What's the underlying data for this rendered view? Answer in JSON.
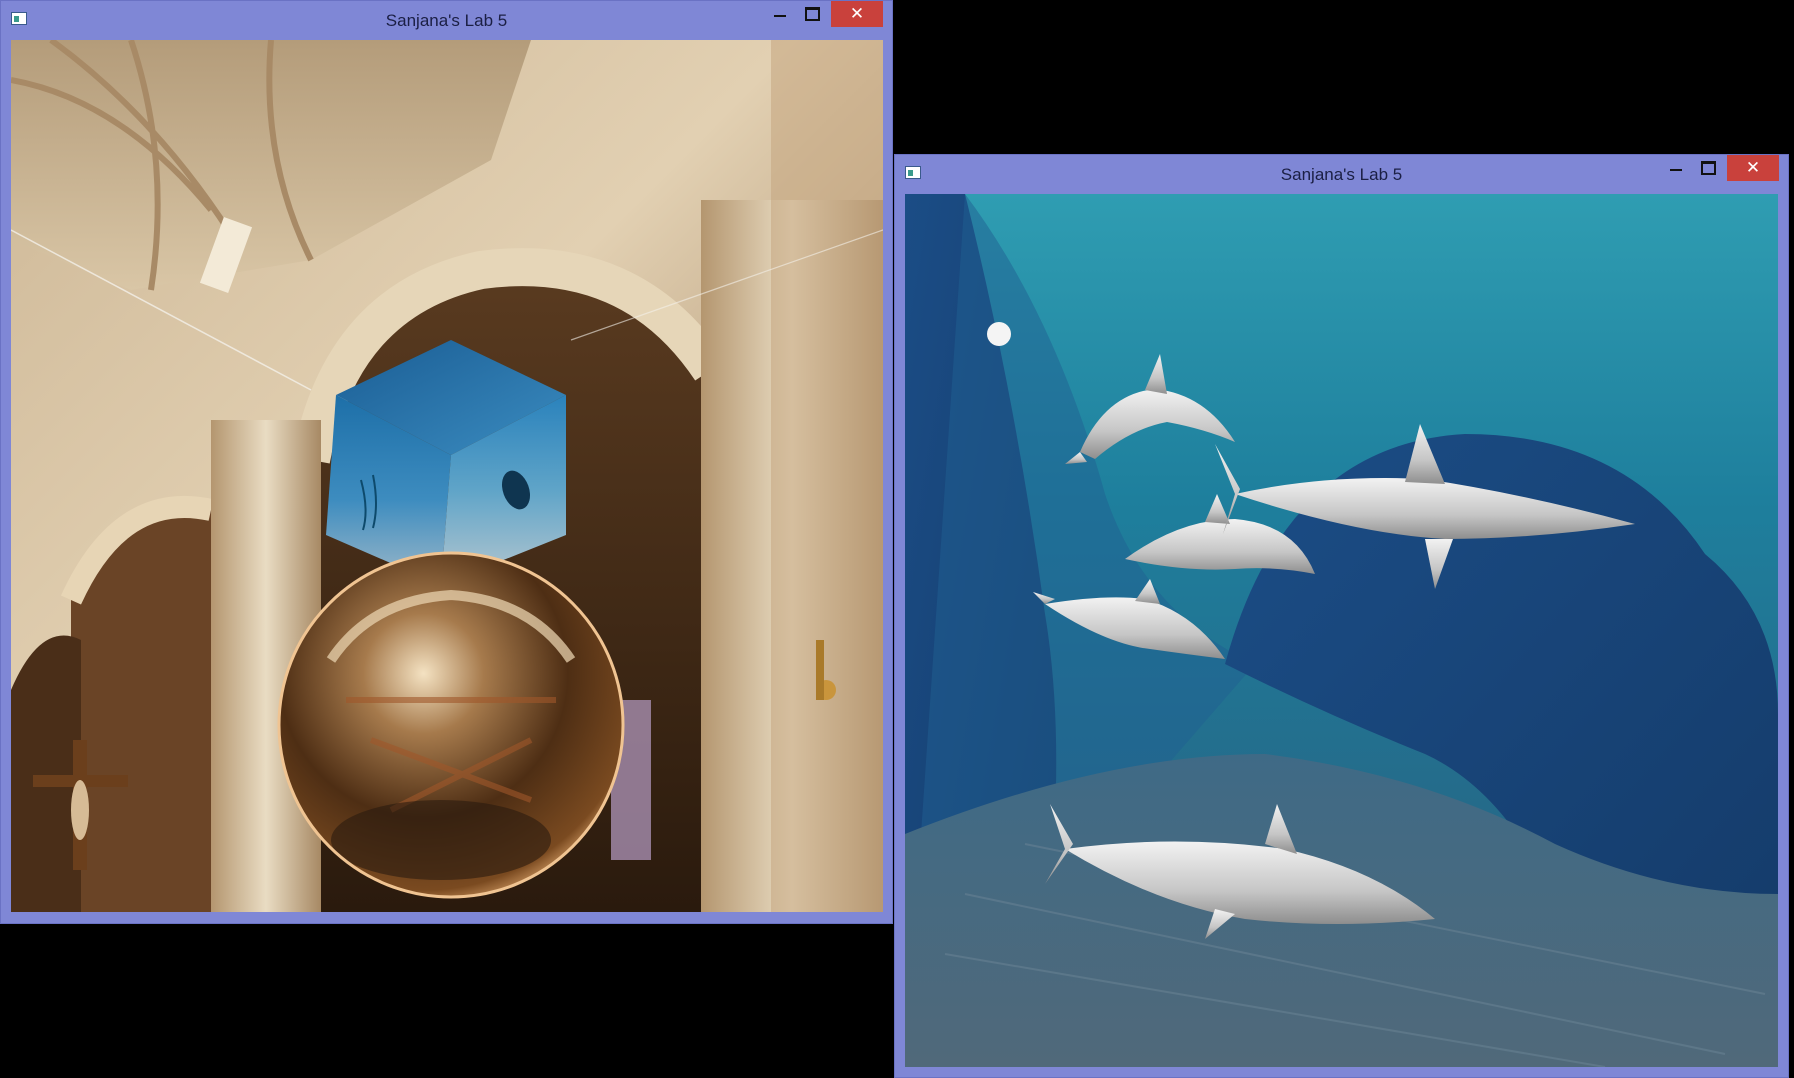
{
  "windows": [
    {
      "title": "Sanjana's Lab 5",
      "close_glyph": "✕"
    },
    {
      "title": "Sanjana's Lab 5",
      "close_glyph": "✕"
    }
  ]
}
